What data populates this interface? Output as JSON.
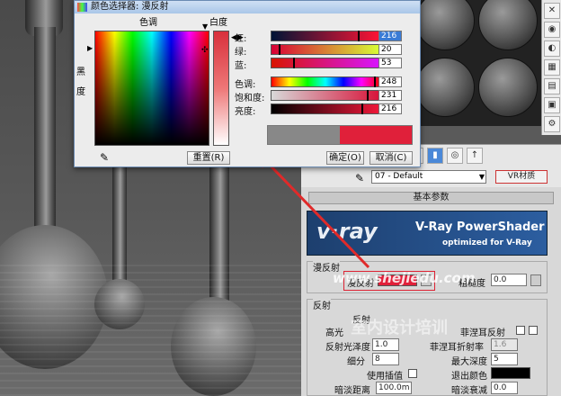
{
  "dialog": {
    "title": "颜色选择器: 漫反射",
    "hue_header": "色调",
    "white_header": "白度",
    "black_label": "黑",
    "degree_label": "度",
    "sliders": [
      {
        "label": "红:",
        "value": "216"
      },
      {
        "label": "绿:",
        "value": "20"
      },
      {
        "label": "蓝:",
        "value": "53"
      },
      {
        "label": "色调:",
        "value": "248"
      },
      {
        "label": "饱和度:",
        "value": "231"
      },
      {
        "label": "亮度:",
        "value": "216"
      }
    ],
    "reset": "重置(R)",
    "ok": "确定(O)",
    "cancel": "取消(C)",
    "new_color": "#e0203a",
    "old_color": "#888888"
  },
  "matbar": {
    "material_name": "07 - Default",
    "material_type": "VR材质"
  },
  "rollout": {
    "basic_params": "基本参数",
    "banner_logo": "v·ray",
    "banner_title": "V-Ray PowerShader",
    "banner_sub": "optimized for V-Ray",
    "diffuse_group": "漫反射",
    "diffuse_label": "漫反射",
    "diffuse_color": "#e0203a",
    "roughness_label": "粗糙度",
    "roughness_value": "0.0",
    "reflect_group": "反射",
    "reflect_label": "反射",
    "fresnel_label": "菲涅耳反射",
    "highlight_label": "高光",
    "gloss_label": "反射光泽度",
    "gloss_value": "1.0",
    "fresnel_ior_label": "菲涅耳折射率",
    "fresnel_ior_value": "1.6",
    "subdiv_label": "细分",
    "subdiv_value": "8",
    "maxdepth_label": "最大深度",
    "maxdepth_value": "5",
    "interp_label": "使用插值",
    "exit_color_label": "退出颜色",
    "dim_dist_label": "暗淡距离",
    "dim_dist_value": "100.0m",
    "dim_falloff_label": "暗淡衰减",
    "dim_falloff_value": "0.0"
  },
  "watermark": {
    "url": "www.shejiedu.com",
    "cn": "室内设计培训"
  }
}
